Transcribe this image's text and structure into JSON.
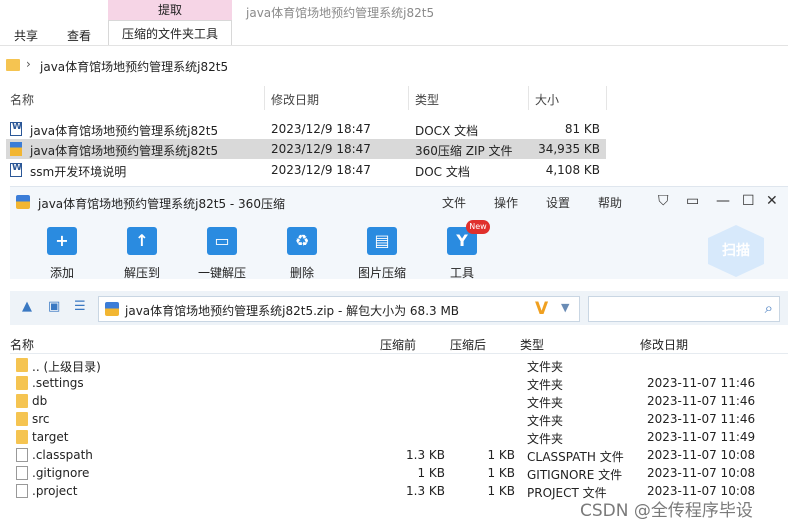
{
  "explorer": {
    "context_tab": "提取",
    "window_title": "java体育馆场地预约管理系统j82t5",
    "tabs": [
      "共享",
      "查看",
      "压缩的文件夹工具"
    ],
    "address": "java体育馆场地预约管理系统j82t5",
    "columns": [
      "名称",
      "修改日期",
      "类型",
      "大小"
    ],
    "files": [
      {
        "name": "java体育馆场地预约管理系统j82t5",
        "date": "2023/12/9 18:47",
        "type": "DOCX 文档",
        "size": "81 KB",
        "icon": "word-doc-icon"
      },
      {
        "name": "java体育馆场地预约管理系统j82t5",
        "date": "2023/12/9 18:47",
        "type": "360压缩 ZIP 文件",
        "size": "34,935 KB",
        "icon": "zip-archive-icon",
        "selected": true
      },
      {
        "name": "ssm开发环境说明",
        "date": "2023/12/9 18:47",
        "type": "DOC 文档",
        "size": "4,108 KB",
        "icon": "word-doc-icon"
      }
    ]
  },
  "zip360": {
    "title": "java体育馆场地预约管理系统j82t5 - 360压缩",
    "menu": [
      "文件",
      "操作",
      "设置",
      "帮助"
    ],
    "toolbar": [
      "添加",
      "解压到",
      "一键解压",
      "删除",
      "图片压缩",
      "工具"
    ],
    "new_badge": "New",
    "scan_label": "扫描",
    "path": "java体育馆场地预约管理系统j82t5.zip - 解包大小为 68.3 MB",
    "columns": [
      "名称",
      "压缩前",
      "压缩后",
      "类型",
      "修改日期"
    ],
    "rows": [
      {
        "name": ".. (上级目录)",
        "before": "",
        "after": "",
        "type": "文件夹",
        "date": "",
        "kind": "folder"
      },
      {
        "name": ".settings",
        "before": "",
        "after": "",
        "type": "文件夹",
        "date": "2023-11-07 11:46",
        "kind": "folder"
      },
      {
        "name": "db",
        "before": "",
        "after": "",
        "type": "文件夹",
        "date": "2023-11-07 11:46",
        "kind": "folder"
      },
      {
        "name": "src",
        "before": "",
        "after": "",
        "type": "文件夹",
        "date": "2023-11-07 11:46",
        "kind": "folder"
      },
      {
        "name": "target",
        "before": "",
        "after": "",
        "type": "文件夹",
        "date": "2023-11-07 11:49",
        "kind": "folder"
      },
      {
        "name": ".classpath",
        "before": "1.3 KB",
        "after": "1 KB",
        "type": "CLASSPATH 文件",
        "date": "2023-11-07 10:08",
        "kind": "file"
      },
      {
        "name": ".gitignore",
        "before": "1 KB",
        "after": "1 KB",
        "type": "GITIGNORE 文件",
        "date": "2023-11-07 10:08",
        "kind": "file"
      },
      {
        "name": ".project",
        "before": "1.3 KB",
        "after": "1 KB",
        "type": "PROJECT 文件",
        "date": "2023-11-07 10:08",
        "kind": "file"
      }
    ]
  },
  "watermark": "CSDN @全传程序毕设"
}
